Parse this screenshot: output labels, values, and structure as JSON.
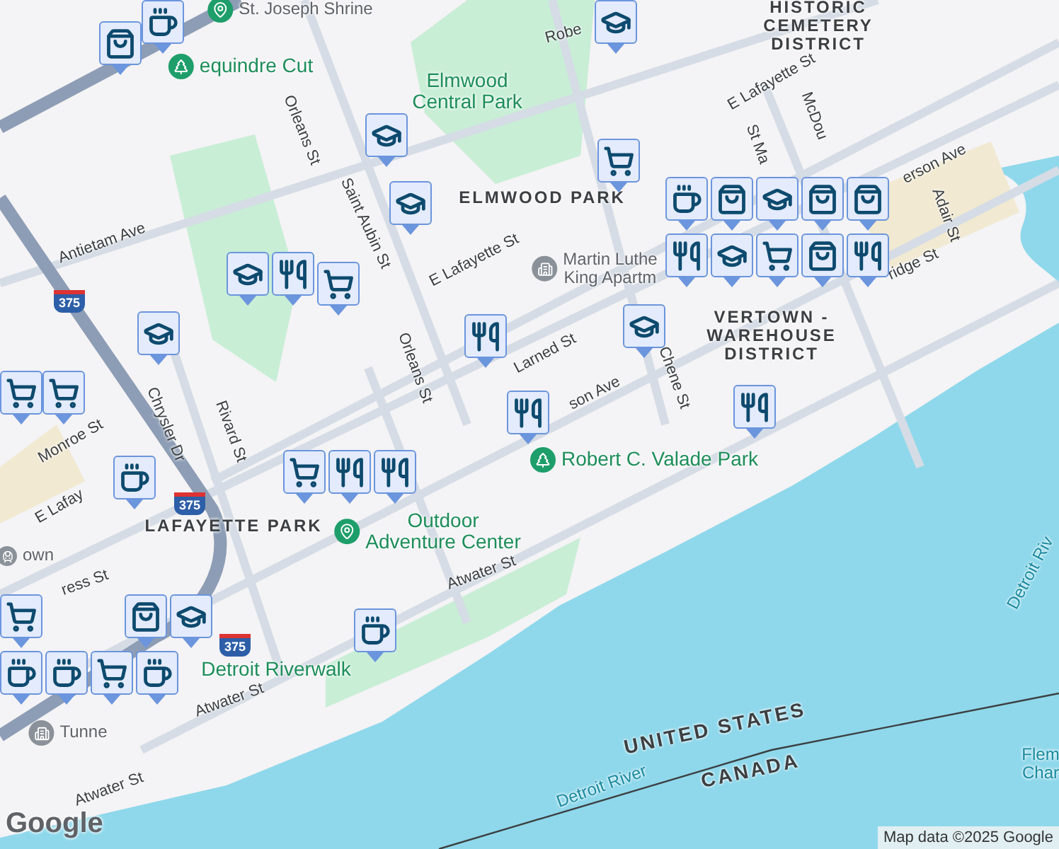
{
  "labels": [
    {
      "text": "St. Joseph Shrine",
      "kind": "poi"
    },
    {
      "text": "HISTORIC\nCEMETERY\nDISTRICT",
      "kind": "area"
    },
    {
      "text": "Robe",
      "kind": "street"
    },
    {
      "text": "equindre Cut",
      "kind": "park"
    },
    {
      "text": "Elmwood\nCentral Park",
      "kind": "park"
    },
    {
      "text": "E Lafayette St",
      "kind": "street"
    },
    {
      "text": "Orleans St",
      "kind": "street"
    },
    {
      "text": "St Ma",
      "kind": "street"
    },
    {
      "text": "McDou",
      "kind": "street"
    },
    {
      "text": "ELMWOOD PARK",
      "kind": "area"
    },
    {
      "text": "Saint Aubin St",
      "kind": "street"
    },
    {
      "text": "Antietam Ave",
      "kind": "street"
    },
    {
      "text": "E Lafayette St",
      "kind": "street"
    },
    {
      "text": "Martin Luthe\nKing Apartm",
      "kind": "poi"
    },
    {
      "text": "erson Ave",
      "kind": "street"
    },
    {
      "text": "Adair St",
      "kind": "street"
    },
    {
      "text": "ridge St",
      "kind": "street"
    },
    {
      "text": "VERTOWN -\nWAREHOUSE\nDISTRICT",
      "kind": "area"
    },
    {
      "text": "Larned St",
      "kind": "street"
    },
    {
      "text": "son Ave",
      "kind": "street"
    },
    {
      "text": "Orleans St",
      "kind": "street"
    },
    {
      "text": "Chene St",
      "kind": "street"
    },
    {
      "text": "Chrysler Dr",
      "kind": "street"
    },
    {
      "text": "Monroe St",
      "kind": "street"
    },
    {
      "text": "Rivard St",
      "kind": "street"
    },
    {
      "text": "Robert C. Valade Park",
      "kind": "park"
    },
    {
      "text": "E Lafay",
      "kind": "street"
    },
    {
      "text": "LAFAYETTE PARK",
      "kind": "area"
    },
    {
      "text": "Outdoor\nAdventure Center",
      "kind": "park"
    },
    {
      "text": "own",
      "kind": "poi"
    },
    {
      "text": "ress St",
      "kind": "street"
    },
    {
      "text": "Atwater St",
      "kind": "street"
    },
    {
      "text": "Detroit Riv",
      "kind": "water"
    },
    {
      "text": "Detroit Riverwalk",
      "kind": "park"
    },
    {
      "text": "Tunne",
      "kind": "poi"
    },
    {
      "text": "Atwater St",
      "kind": "street"
    },
    {
      "text": "UNITED STATES",
      "kind": "border"
    },
    {
      "text": "CANADA",
      "kind": "border"
    },
    {
      "text": "Flem\nChar",
      "kind": "water"
    },
    {
      "text": "Detroit River",
      "kind": "water"
    },
    {
      "text": "Atwater St",
      "kind": "street"
    }
  ],
  "highway_shields": [
    {
      "label": "375"
    },
    {
      "label": "375"
    },
    {
      "label": "375"
    }
  ],
  "markers": [
    {
      "kind": "cafe"
    },
    {
      "kind": "shop"
    },
    {
      "kind": "school"
    },
    {
      "kind": "school"
    },
    {
      "kind": "cart"
    },
    {
      "kind": "school"
    },
    {
      "kind": "shop"
    },
    {
      "kind": "shop"
    },
    {
      "kind": "school"
    },
    {
      "kind": "cafe"
    },
    {
      "kind": "school"
    },
    {
      "kind": "food"
    },
    {
      "kind": "cart"
    },
    {
      "kind": "food"
    },
    {
      "kind": "shop"
    },
    {
      "kind": "shop"
    },
    {
      "kind": "school"
    },
    {
      "kind": "food"
    },
    {
      "kind": "cart"
    },
    {
      "kind": "school"
    },
    {
      "kind": "cart"
    },
    {
      "kind": "cart"
    },
    {
      "kind": "food"
    },
    {
      "kind": "school"
    },
    {
      "kind": "food"
    },
    {
      "kind": "cafe"
    },
    {
      "kind": "food"
    },
    {
      "kind": "cart"
    },
    {
      "kind": "food"
    },
    {
      "kind": "food"
    },
    {
      "kind": "cart"
    },
    {
      "kind": "cafe"
    },
    {
      "kind": "shop"
    },
    {
      "kind": "school"
    },
    {
      "kind": "cafe"
    },
    {
      "kind": "cart"
    },
    {
      "kind": "cafe"
    },
    {
      "kind": "cafe"
    }
  ],
  "logo": "Google",
  "attribution": "Map data ©2025 Google"
}
